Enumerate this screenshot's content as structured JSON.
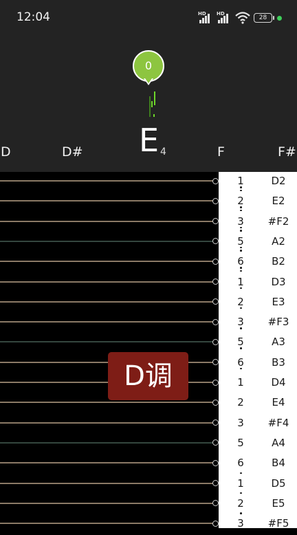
{
  "status_bar": {
    "time": "12:04",
    "battery": "28"
  },
  "tuner": {
    "cents": "0",
    "current_note": "E",
    "current_octave": "4",
    "scale_notes": [
      "D",
      "D#",
      "F",
      "F#"
    ]
  },
  "key_badge": "D调",
  "note_rows": [
    {
      "jianpu": "1",
      "note": "D2",
      "dots_below": 2
    },
    {
      "jianpu": "2",
      "note": "E2",
      "dots_below": 2
    },
    {
      "jianpu": "3",
      "note": "#F2",
      "dots_below": 2
    },
    {
      "jianpu": "5",
      "note": "A2",
      "dots_below": 2
    },
    {
      "jianpu": "6",
      "note": "B2",
      "dots_below": 2
    },
    {
      "jianpu": "1",
      "note": "D3",
      "dots_below": 1
    },
    {
      "jianpu": "2",
      "note": "E3",
      "dots_below": 1
    },
    {
      "jianpu": "3",
      "note": "#F3",
      "dots_below": 1
    },
    {
      "jianpu": "5",
      "note": "A3",
      "dots_below": 1
    },
    {
      "jianpu": "6",
      "note": "B3",
      "dots_below": 1
    },
    {
      "jianpu": "1",
      "note": "D4",
      "dots_below": 0
    },
    {
      "jianpu": "2",
      "note": "E4",
      "dots_below": 0
    },
    {
      "jianpu": "3",
      "note": "#F4",
      "dots_below": 0
    },
    {
      "jianpu": "5",
      "note": "A4",
      "dots_below": 0
    },
    {
      "jianpu": "6",
      "note": "B4",
      "dots_below": 0
    },
    {
      "jianpu": "1",
      "note": "D5",
      "dots_above": 1
    },
    {
      "jianpu": "2",
      "note": "E5",
      "dots_above": 1
    },
    {
      "jianpu": "3",
      "note": "#F5",
      "dots_above": 1
    }
  ],
  "colors": {
    "top_panel": "#232323",
    "pin": "#8dc540",
    "needle": "#6ed62a",
    "string": "#8b7a66",
    "string_highlight": "#34463e",
    "key_badge": "#7e1d16"
  }
}
